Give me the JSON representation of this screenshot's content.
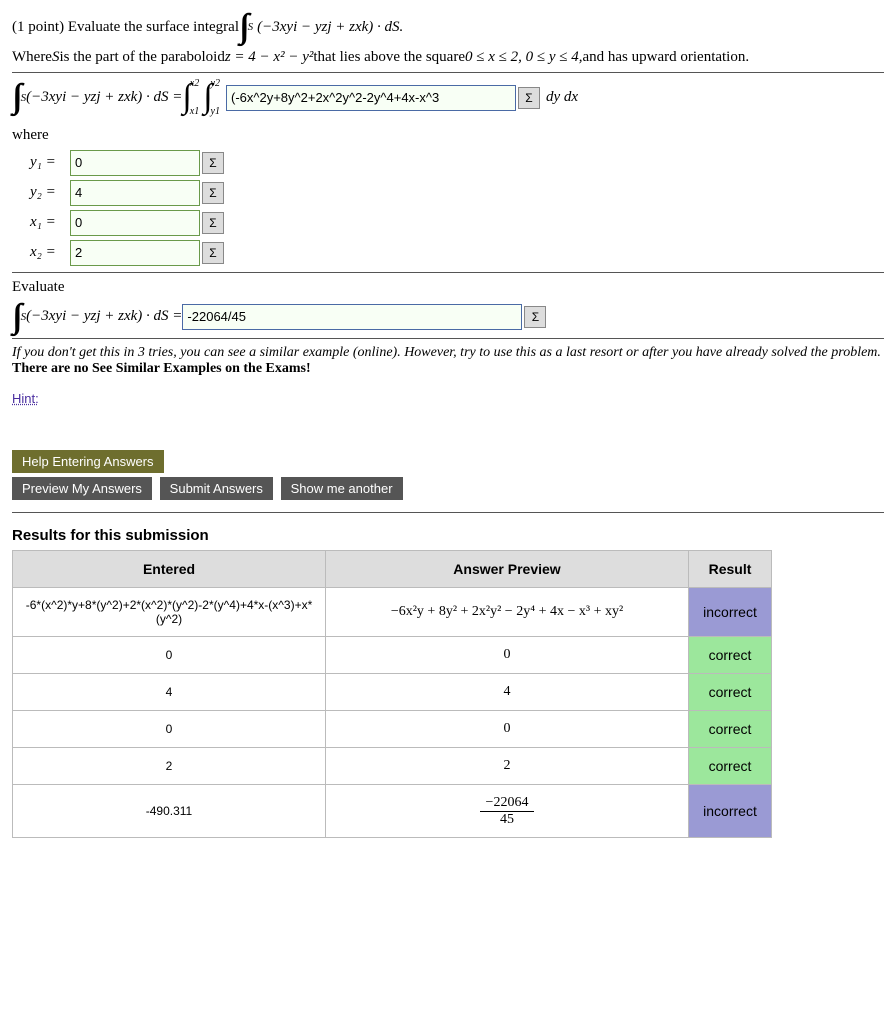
{
  "q": {
    "prefix": "(1 point) Evaluate the surface integral ",
    "vecfield_tex": "(−3xyi − yzj + zxk) · dS.",
    "where1": "Where ",
    "surface": "S",
    "where2": " is the part of the paraboloid ",
    "zeq": "z = 4 − x² − y²",
    "where3": " that lies above the square ",
    "range": "0 ≤ x ≤ 2,  0 ≤ y ≤ 4,",
    "where4": " and has upward orientation."
  },
  "setup": {
    "lhs": "(−3xyi − yzj + zxk) · dS = ",
    "x2": "x2",
    "x1": "x1",
    "y2": "y2",
    "y1": "y1",
    "integrand_input": "(-6x^2y+8y^2+2x^2y^2-2y^4+4x-x^3",
    "dydx": " dy dx"
  },
  "where_label": "where",
  "limits": {
    "y1_label": "y₁ = ",
    "y1": "0",
    "y2_label": "y₂ = ",
    "y2": "4",
    "x1_label": "x₁ = ",
    "x1": "0",
    "x2_label": "x₂ = ",
    "x2": "2"
  },
  "evaluate_label": "Evaluate",
  "eval_lhs": "(−3xyi − yzj + zxk) · dS = ",
  "eval_input": "-22064/45",
  "note": "If you don't get this in 3 tries, you can see a similar example (online). However, try to use this as a last resort or after you have already solved the problem. ",
  "note_bold": "There are no See Similar Examples on the Exams!",
  "hint_label": "Hint:",
  "buttons": {
    "help": "Help Entering Answers",
    "preview": "Preview My Answers",
    "submit": "Submit Answers",
    "another": "Show me another"
  },
  "results_hdr": "Results for this submission",
  "table": {
    "h1": "Entered",
    "h2": "Answer Preview",
    "h3": "Result",
    "rows": [
      {
        "entered": "-6*(x^2)*y+8*(y^2)+2*(x^2)*(y^2)-2*(y^4)+4*x-(x^3)+x*(y^2)",
        "preview": "−6x²y + 8y² + 2x²y² − 2y⁴ + 4x − x³ + xy²",
        "result": "incorrect",
        "cls": "result-incorrect"
      },
      {
        "entered": "0",
        "preview": "0",
        "result": "correct",
        "cls": "result-correct"
      },
      {
        "entered": "4",
        "preview": "4",
        "result": "correct",
        "cls": "result-correct"
      },
      {
        "entered": "0",
        "preview": "0",
        "result": "correct",
        "cls": "result-correct"
      },
      {
        "entered": "2",
        "preview": "2",
        "result": "correct",
        "cls": "result-correct"
      },
      {
        "entered": "-490.311",
        "preview_frac": {
          "num": "−22064",
          "den": "45"
        },
        "result": "incorrect",
        "cls": "result-incorrect"
      }
    ]
  },
  "sigma": "Σ",
  "S_sub": "S"
}
